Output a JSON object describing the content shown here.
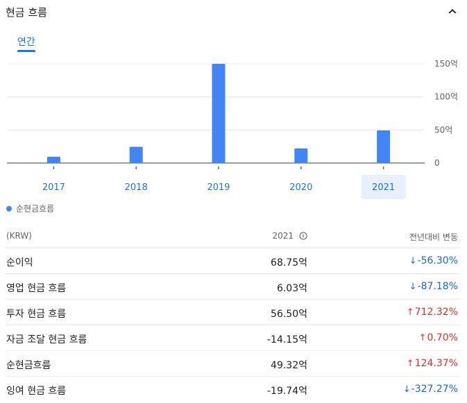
{
  "header": {
    "title": "현금 흐름"
  },
  "tabs": [
    {
      "label": "연간",
      "active": true
    }
  ],
  "colors": {
    "accent": "#1a73e8",
    "bar": "#4285f4",
    "negative": "#d93025",
    "positive": "#1967d2"
  },
  "chart_data": {
    "type": "bar",
    "categories": [
      "2017",
      "2018",
      "2019",
      "2020",
      "2021"
    ],
    "series": [
      {
        "name": "순현금흐름",
        "values": [
          9.5,
          24.5,
          150,
          22,
          49.32
        ]
      }
    ],
    "yticks": [
      "0",
      "50억",
      "100억",
      "150억"
    ],
    "ytick_values": [
      0,
      50,
      100,
      150
    ],
    "ylim": [
      0,
      150
    ],
    "selected_category": "2021",
    "grid": true,
    "legend_position": "bottom-left"
  },
  "legend": {
    "label": "순현금흐름"
  },
  "table": {
    "columns": {
      "currency": "(KRW)",
      "year": "2021",
      "change": "전년대비 변동"
    },
    "rows": [
      {
        "label": "순이익",
        "value": "68.75억",
        "change": "-56.30%",
        "direction": "down"
      },
      {
        "label": "영업 현금 흐름",
        "value": "6.03억",
        "change": "-87.18%",
        "direction": "down"
      },
      {
        "label": "투자 현금 흐름",
        "value": "56.50억",
        "change": "712.32%",
        "direction": "up"
      },
      {
        "label": "자금 조달 현금 흐름",
        "value": "-14.15억",
        "change": "0.70%",
        "direction": "up"
      },
      {
        "label": "순현금흐름",
        "value": "49.32억",
        "change": "124.37%",
        "direction": "up"
      },
      {
        "label": "잉여 현금 흐름",
        "value": "-19.74억",
        "change": "-327.27%",
        "direction": "down"
      }
    ]
  }
}
